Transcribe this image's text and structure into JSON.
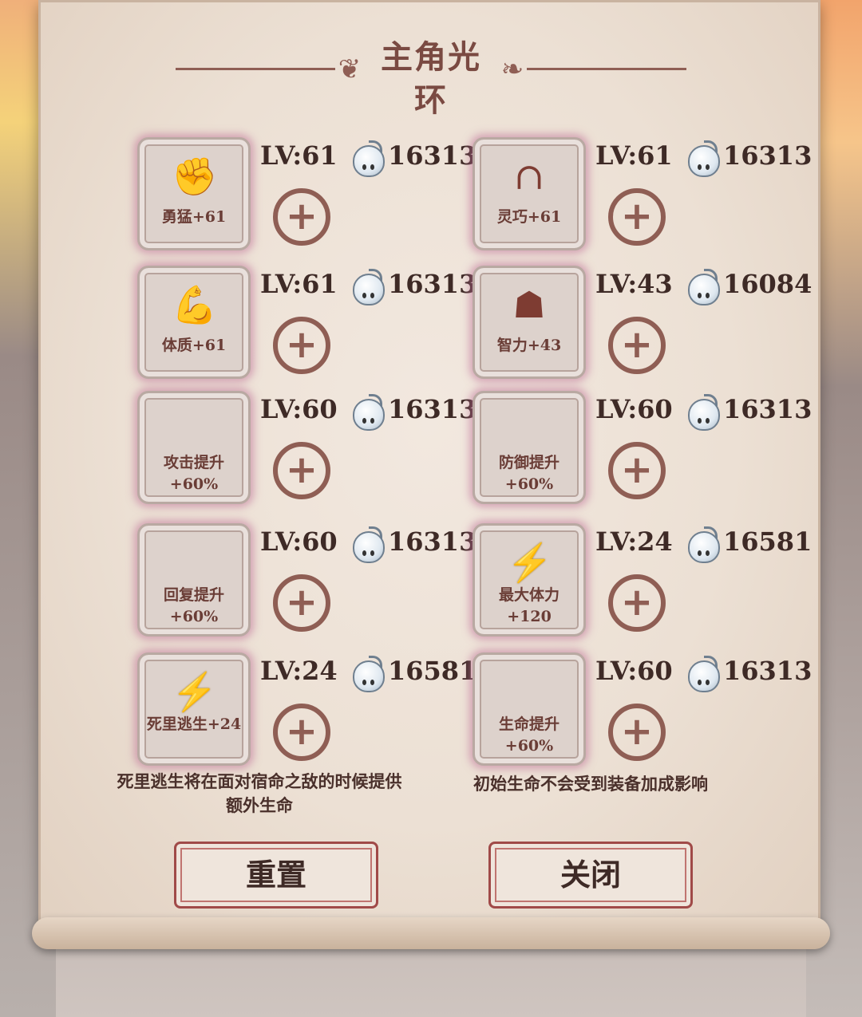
{
  "panel": {
    "title": "主角光环"
  },
  "slots": [
    {
      "label": "勇猛+61",
      "level": "LV:61",
      "cost": "16313",
      "icon": "fist-icon"
    },
    {
      "label": "灵巧+61",
      "level": "LV:61",
      "cost": "16313",
      "icon": "cloak-icon"
    },
    {
      "label": "体质+61",
      "level": "LV:61",
      "cost": "16313",
      "icon": "muscle-arm-icon"
    },
    {
      "label": "智力+43",
      "level": "LV:43",
      "cost": "16084",
      "icon": "brain-head-icon"
    },
    {
      "label": "攻击提升+60%",
      "level": "LV:60",
      "cost": "16313",
      "icon": ""
    },
    {
      "label": "防御提升+60%",
      "level": "LV:60",
      "cost": "16313",
      "icon": ""
    },
    {
      "label": "回复提升+60%",
      "level": "LV:60",
      "cost": "16313",
      "icon": ""
    },
    {
      "label": "最大体力+120",
      "level": "LV:24",
      "cost": "16581",
      "icon": "lightning-icon"
    },
    {
      "label": "死里逃生+24",
      "level": "LV:24",
      "cost": "16581",
      "icon": "lightning-icon"
    },
    {
      "label": "生命提升+60%",
      "level": "LV:60",
      "cost": "16313",
      "icon": ""
    }
  ],
  "notes": {
    "left": "死里逃生将在面对宿命之敌的时候提供额外生命",
    "right": "初始生命不会受到装备加成影响"
  },
  "buttons": {
    "reset": "重置",
    "close": "关闭"
  },
  "colors": {
    "parchment": "#ece0d4",
    "accent_brown": "#8f5e54",
    "button_border": "#a04a48",
    "glow_pink": "#be6e96"
  }
}
